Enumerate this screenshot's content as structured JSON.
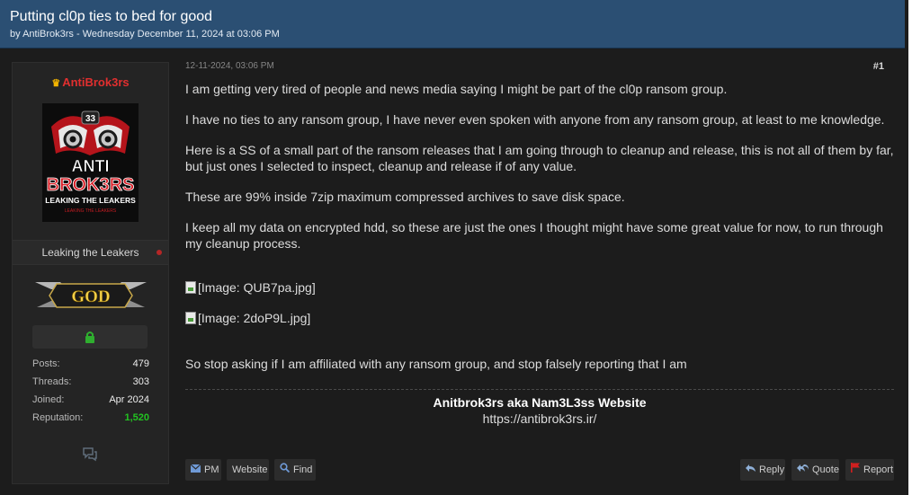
{
  "thread": {
    "title": "Putting cl0p ties to bed for good",
    "meta": "by AntiBrok3rs - Wednesday December 11, 2024 at 03:06 PM"
  },
  "user": {
    "name": "AntiBrok3rs",
    "avatar_text": {
      "number": "33",
      "line1": "ANTI",
      "line2": "BROK3RS",
      "line3": "LEAKING THE LEAKERS",
      "line4": "LEAKING THE LEAKERS"
    },
    "usertitle": "Leaking the Leakers",
    "rank": "GOD",
    "stats": [
      {
        "label": "Posts:",
        "value": "479"
      },
      {
        "label": "Threads:",
        "value": "303"
      },
      {
        "label": "Joined:",
        "value": "Apr 2024"
      },
      {
        "label": "Reputation:",
        "value": "1,520"
      }
    ]
  },
  "post": {
    "date": "12-11-2024, 03:06 PM",
    "number": "#1",
    "paragraphs": [
      "I am getting very tired of people and news media saying I might be part of the cl0p ransom group.",
      "I have no ties to any ransom group, I have never even spoken with anyone from any ransom group, at least to me knowledge.",
      "Here is a SS of a small part of the ransom releases that I am going through to cleanup and release, this is not all of them by far, but just ones I selected to inspect, cleanup and release if of any value.",
      "These are 99% inside 7zip maximum compressed archives to save disk space.",
      "I keep all my data on encrypted hdd, so these are just the ones I thought might have some great value for now, to run through my cleanup process."
    ],
    "images": [
      "[Image: QUB7pa.jpg]",
      "[Image: 2doP9L.jpg]"
    ],
    "closing": "So stop asking if I am affiliated with any ransom group, and stop falsely reporting that I am",
    "signature": {
      "title": "Anitbrok3rs aka Nam3L3ss Website",
      "url": "https://antibrok3rs.ir/"
    }
  },
  "buttons": {
    "pm": "PM",
    "website": "Website",
    "find": "Find",
    "reply": "Reply",
    "quote": "Quote",
    "report": "Report"
  },
  "colors": {
    "header": "#2b4f73",
    "background": "#1c1c1c",
    "username": "#e12f2f",
    "reputation": "#22c321"
  }
}
